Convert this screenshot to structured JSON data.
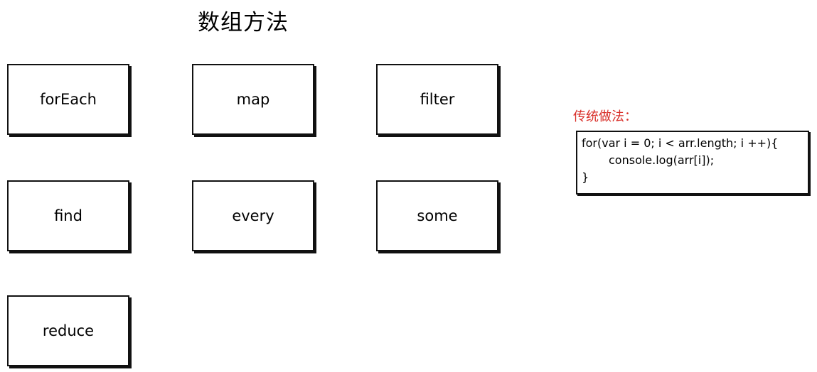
{
  "title": "数组方法",
  "methods": [
    {
      "label": "forEach"
    },
    {
      "label": "map"
    },
    {
      "label": "filter"
    },
    {
      "label": "find"
    },
    {
      "label": "every"
    },
    {
      "label": "some"
    },
    {
      "label": "reduce"
    }
  ],
  "traditional": {
    "label": "传统做法：",
    "code_lines": [
      "for(var i = 0; i < arr.length; i ++){",
      "console.log(arr[i]);",
      "}"
    ]
  }
}
